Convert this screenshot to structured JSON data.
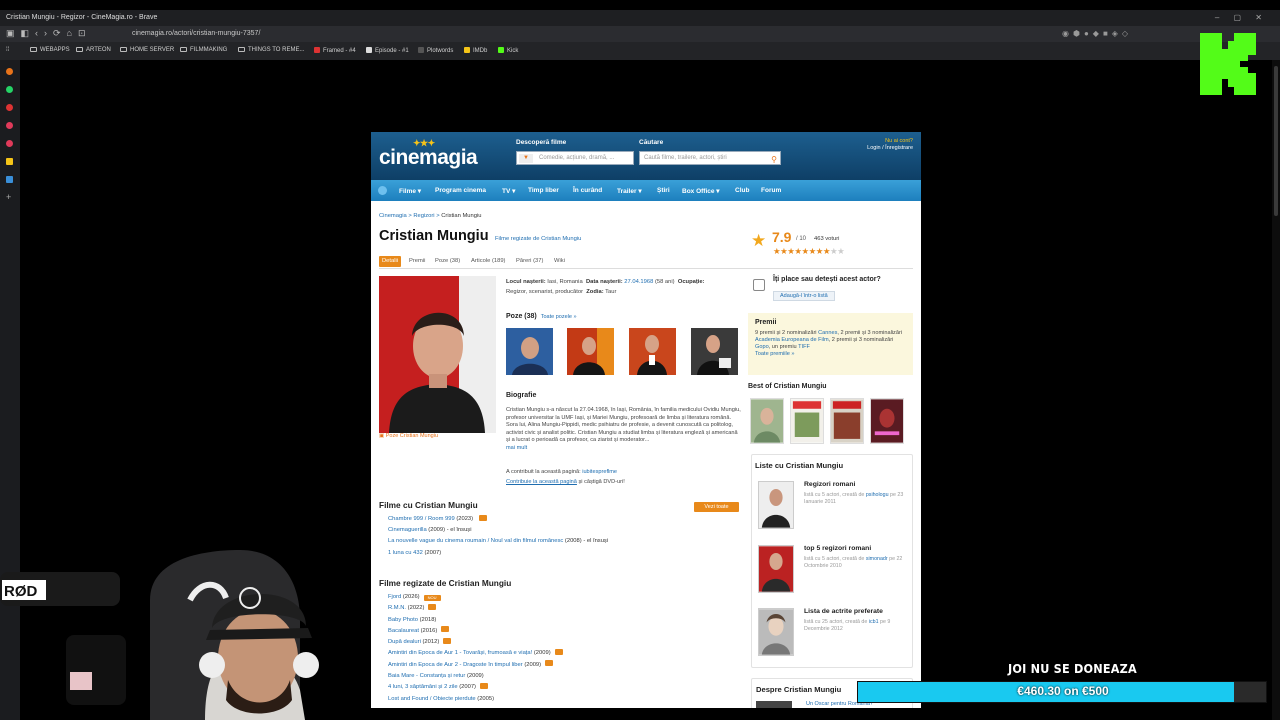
{
  "browser": {
    "title": "Cristian Mungiu - Regizor - CineMagia.ro - Brave",
    "url": "cinemagia.ro/actori/cristian-mungiu-7357/",
    "bookmarks": [
      "WEBAPPS",
      "ARTEON",
      "HOME SERVER",
      "FILMMAKING",
      "THINGS TO REME...",
      "Framed - #4",
      "Episode - #1",
      "Plotwords",
      "IMDb",
      "Kick"
    ]
  },
  "site": {
    "logo": "cinemagia",
    "discover_label": "Descoperă filme",
    "discover_placeholder": "Comedie, acțiune, dramă, ...",
    "search_label": "Căutare",
    "search_placeholder": "Caută filme, trailere, actori, știri",
    "login_q": "Nu ai cont?",
    "login": "Login / Înregistrare",
    "nav": [
      "Filme ▾",
      "Program cinema",
      "TV ▾",
      "Timp liber",
      "În curând",
      "Trailer ▾",
      "Știri",
      "Box Office ▾",
      "Club",
      "Forum"
    ]
  },
  "breadcrumb": {
    "a": "Cinemagia",
    "b": "Regizori",
    "c": "Cristian Mungiu"
  },
  "person": {
    "name": "Cristian Mungiu",
    "films_link": "Filme regizate de Cristian Mungiu",
    "rating": "7.9",
    "rating_of": "/ 10",
    "votes": "463 voturi",
    "rating_value": 7.9,
    "tabs": [
      "Detalii",
      "Premii",
      "Poze (38)",
      "Articole (189)",
      "Păreri (37)",
      "Wiki"
    ],
    "photo_caption": "Poze Cristian Mungiu",
    "birthplace_label": "Locul nașterii:",
    "birthplace": "Iasi, Romania",
    "birthdate_label": "Data nașterii:",
    "birthdate": "27.04.1968",
    "age": "(58 ani)",
    "occupation_label": "Ocupație:",
    "occupation": "Regizor, scenarist, producător",
    "zodiac_label": "Zodia:",
    "zodiac": "Taur",
    "poze_title": "Poze (38)",
    "poze_all": "Toate pozele »",
    "bio_title": "Biografie",
    "bio": "Cristian Mungiu s-a născut la 27.04.1968, în Iași, România, în familia medicului Ovidiu Mungiu, profesor universitar la UMF Iași, și Mariei Mungiu, profesoară de limba și literatura română. Sora lui, Alina Mungiu-Pippidi, medic psihiatru de profesie, a devenit cunoscută ca politolog, activist civic și analist politic. Cristian Mungiu a studiat limba și literatura engleză și americană și a lucrat o perioadă ca profesor, ca ziarist și moderator...",
    "bio_more": "mai mult",
    "contrib_text": "A contribuit la această pagină:",
    "contrib_user": "iubitespreflme",
    "contrib_link": "Contribuie la această pagină",
    "contrib_tail": "și câștigă DVD-uri!"
  },
  "films": {
    "title": "Filme cu Cristian Mungiu",
    "more": "Vezi toate",
    "items": [
      {
        "t": "Chambre 999 / Room 999",
        "y": "(2023)",
        "r": "",
        "p": true
      },
      {
        "t": "Cinemaguerilla",
        "y": "(2009)",
        "r": "- el însuși",
        "p": false
      },
      {
        "t": "La nouvelle vague du cinema roumain / Noul val din filmul românesc",
        "y": "(2008)",
        "r": "- el însuși",
        "p": false
      },
      {
        "t": "1 luna cu 432",
        "y": "(2007)",
        "r": "",
        "p": false
      }
    ]
  },
  "directed": {
    "title": "Filme regizate de Cristian Mungiu",
    "items": [
      {
        "t": "Fjord",
        "y": "(2026)",
        "tag": "NOU"
      },
      {
        "t": "R.M.N.",
        "y": "(2022)",
        "tag": "p"
      },
      {
        "t": "Baby Photo",
        "y": "(2018)",
        "tag": ""
      },
      {
        "t": "Bacalaureat",
        "y": "(2016)",
        "tag": "p"
      },
      {
        "t": "După dealuri",
        "y": "(2012)",
        "tag": "p"
      },
      {
        "t": "Amintiri din Epoca de Aur 1 - Tovarăși, frumoasă e viața!",
        "y": "(2009)",
        "tag": "p"
      },
      {
        "t": "Amintiri din Epoca de Aur 2 - Dragoste în timpul liber",
        "y": "(2009)",
        "tag": "p"
      },
      {
        "t": "Baia Mare - Constanța și retur",
        "y": "(2009)",
        "tag": ""
      },
      {
        "t": "4 luni, 3 săptămâni și 2 zile",
        "y": "(2007)",
        "tag": "p"
      },
      {
        "t": "Lost and Found / Obiecte pierdute",
        "y": "(2005)",
        "tag": ""
      }
    ]
  },
  "sidebar": {
    "like_q": "Îți place sau detești acest actor?",
    "like_btn": "Adaugă-l într-o listă",
    "awards_title": "Premii",
    "awards_a": "9 premii și 2 nominalizări",
    "awards_b": "Cannes",
    "awards_c": ", 2 premii și 3 nominalizări",
    "awards_d": "Academia Europeana de Film",
    "awards_e": ", 2 premii și 3 nominalizări",
    "awards_f": "Gopo",
    "awards_g": ", un premiu",
    "awards_h": "TIFF",
    "awards_all": "Toate premiile »",
    "best_title": "Best of Cristian Mungiu",
    "lists_title": "Liste cu Cristian Mungiu",
    "lists": [
      {
        "n": "Regizori romani",
        "a": "listă cu 5 actori, creată de",
        "u": "psihologu",
        "d": "pe 23 Ianuarie 2011"
      },
      {
        "n": "top 5 regizori romani",
        "a": "listă cu 5 actori, creată de",
        "u": "simonadr",
        "d": "pe 22 Octombrie 2010"
      },
      {
        "n": "Lista de actrite preferate",
        "a": "listă cu 25 actori, creată de",
        "u": "icb1",
        "d": "pe 9 Decembrie 2012"
      }
    ],
    "about_title": "Despre Cristian Mungiu",
    "about_item": "Un Oscar pentru Romania?"
  },
  "stream": {
    "donate_title": "JOI NU SE DONEAZA",
    "donate_text": "€460.30 on €500",
    "donate_progress": 0.9206
  },
  "colors": {
    "accent": "#e8891a",
    "link": "#1e6db0",
    "nav": "#2a8fcd",
    "kick": "#53fc18",
    "bar": "#19c9f0"
  }
}
